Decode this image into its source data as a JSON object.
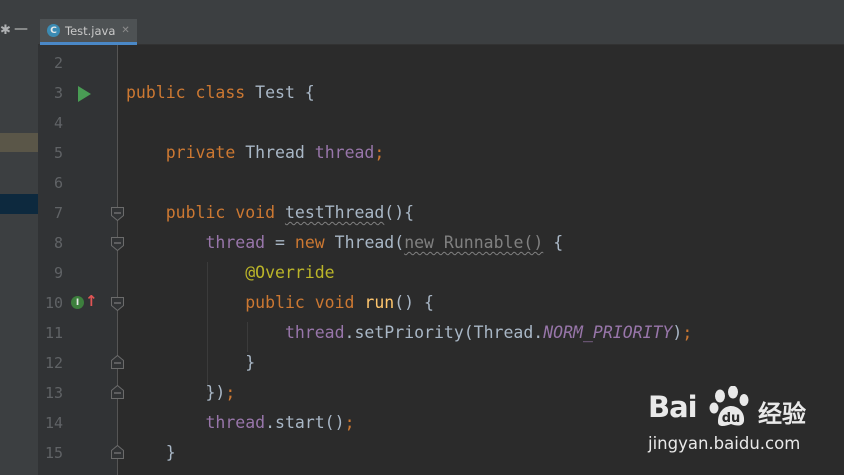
{
  "editor": {
    "tab": {
      "icon_letter": "C",
      "filename": "Test.java"
    },
    "side_tools": {
      "gear_icon": "gear-icon",
      "minimize_icon": "minimize-icon"
    },
    "gutter_icons": {
      "run": "run-icon",
      "implements": "I",
      "override_arrow": "↑"
    }
  },
  "code": {
    "l2": {
      "num": "2"
    },
    "l3": {
      "num": "3",
      "t1": "public class ",
      "t2": "Test {"
    },
    "l4": {
      "num": "4"
    },
    "l5": {
      "num": "5",
      "t1": "    private ",
      "t2": "Thread ",
      "t3": "thread",
      "t4": ";"
    },
    "l6": {
      "num": "6"
    },
    "l7": {
      "num": "7",
      "t1": "    public void ",
      "t2": "testThread",
      "t3": "(){"
    },
    "l8": {
      "num": "8",
      "t1": "        thread",
      "t2": " = ",
      "t3": "new ",
      "t4": "Thread(",
      "t5": "new Runnable()",
      "t6": " {"
    },
    "l9": {
      "num": "9",
      "t1": "            @Override"
    },
    "l10": {
      "num": "10",
      "t1": "            public void ",
      "t2": "run",
      "t3": "() {"
    },
    "l11": {
      "num": "11",
      "t1": "                thread",
      "t2": ".setPriority(Thread.",
      "t3": "NORM_PRIORITY",
      "t4": ")",
      "t5": ";"
    },
    "l12": {
      "num": "12",
      "t1": "            }"
    },
    "l13": {
      "num": "13",
      "t1": "        })",
      "t2": ";"
    },
    "l14": {
      "num": "14",
      "t1": "        thread",
      "t2": ".start()",
      "t3": ";"
    },
    "l15": {
      "num": "15",
      "t1": "    }"
    }
  },
  "watermark": {
    "brand": "Bai",
    "brand_cn": "经验",
    "url": "jingyan.baidu.com"
  },
  "colors": {
    "background": "#2b2b2b",
    "keyword": "#cc7832",
    "field": "#9876aa",
    "method": "#ffc66d",
    "annotation": "#bbb529",
    "text": "#a9b7c6",
    "line_number": "#606366"
  }
}
